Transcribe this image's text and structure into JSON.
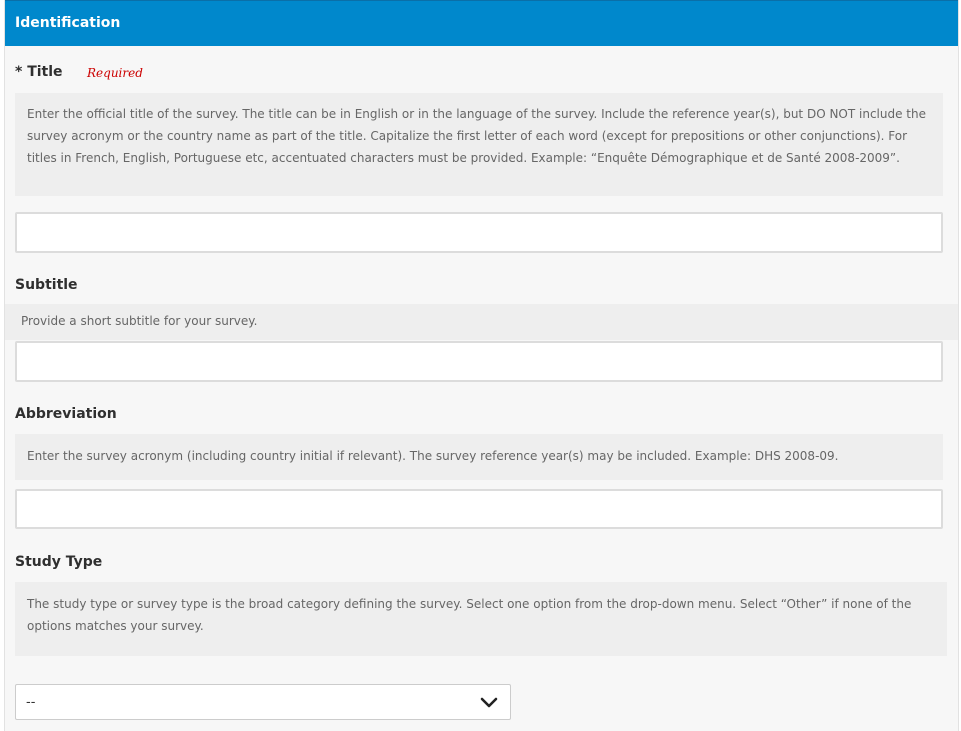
{
  "section": {
    "title": "Identification"
  },
  "fields": {
    "title": {
      "label": "* Title",
      "required_label": "Required",
      "help": "Enter the official title of the survey. The title can be in English or in the language of the survey. Include the reference year(s), but DO NOT include the survey acronym or the country name as part of the title. Capitalize the first letter of each word (except for prepositions or other conjunctions). For titles in French, English, Portuguese etc, accentuated characters must be provided. Example: “Enquête Démographique et de Santé 2008-2009”.",
      "value": ""
    },
    "subtitle": {
      "label": "Subtitle",
      "help": "Provide a short subtitle for your survey.",
      "value": ""
    },
    "abbreviation": {
      "label": "Abbreviation",
      "help": "Enter the survey acronym (including country initial if relevant). The survey reference year(s) may be included. Example: DHS 2008-09.",
      "value": ""
    },
    "study_type": {
      "label": "Study Type",
      "help": "The study type or survey type is the broad category defining the survey. Select one option from the drop-down menu. Select “Other” if none of the options matches your survey.",
      "selected": "--"
    }
  },
  "icons": {
    "dropdown": "chevron-down-icon"
  },
  "colors": {
    "header_bg": "#0088cc",
    "required": "#cc0000",
    "help_bg": "#eeeeee"
  }
}
